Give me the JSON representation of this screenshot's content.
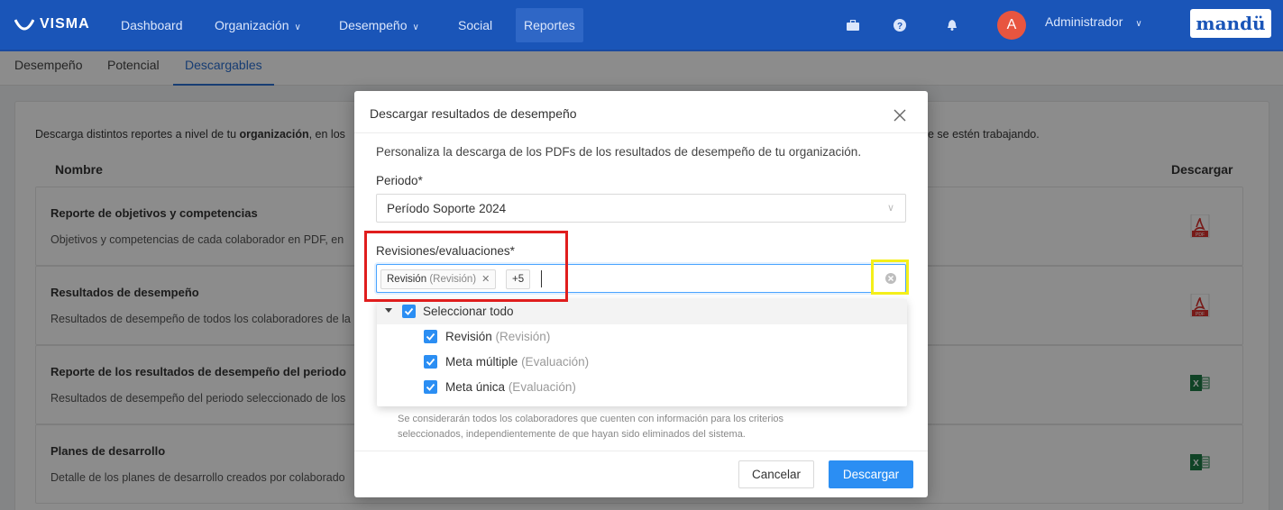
{
  "topbar": {
    "logo": "VISMA",
    "nav": [
      {
        "label": "Dashboard",
        "chevron": false
      },
      {
        "label": "Organización",
        "chevron": true
      },
      {
        "label": "Desempeño",
        "chevron": true
      },
      {
        "label": "Social",
        "chevron": false
      },
      {
        "label": "Reportes",
        "chevron": false,
        "active": true
      }
    ],
    "avatar_initial": "A",
    "user_name": "Administrador",
    "brand": "mandü",
    "icons": [
      "briefcase-icon",
      "help-icon",
      "bell-icon"
    ]
  },
  "subtabs": [
    {
      "label": "Desempeño"
    },
    {
      "label": "Potencial"
    },
    {
      "label": "Descargables",
      "active": true
    }
  ],
  "page": {
    "intro_left_prefix": "Descarga distintos reportes a nivel de tu ",
    "intro_left_bold": "organización",
    "intro_left_suffix": ", en los",
    "intro_right": "e se estén trabajando.",
    "col_name": "Nombre",
    "col_download": "Descargar",
    "reports": [
      {
        "title": "Reporte de objetivos y competencias",
        "desc": "Objetivos y competencias de cada colaborador en PDF, en",
        "file": "pdf"
      },
      {
        "title": "Resultados de desempeño",
        "desc": "Resultados de desempeño de todos los colaboradores de la",
        "file": "pdf"
      },
      {
        "title": "Reporte de los resultados de desempeño del periodo",
        "desc": "Resultados de desempeño del periodo seleccionado de los",
        "file": "excel"
      },
      {
        "title": "Planes de desarrollo",
        "desc": "Detalle de los planes de desarrollo creados por colaborado",
        "file": "excel"
      }
    ]
  },
  "modal": {
    "title": "Descargar resultados de desempeño",
    "description": "Personaliza la descarga de los PDFs de los resultados de desempeño de tu organización.",
    "period_label": "Periodo*",
    "period_value": "Período Soporte 2024",
    "reviews_label": "Revisiones/evaluaciones*",
    "tag": {
      "name": "Revisión",
      "type": "(Revisión)"
    },
    "more_count": "+5",
    "select_all": "Seleccionar todo",
    "options": [
      {
        "name": "Revisión",
        "type": "(Revisión)",
        "checked": true
      },
      {
        "name": "Meta múltiple",
        "type": "(Evaluación)",
        "checked": true
      },
      {
        "name": "Meta única",
        "type": "(Evaluación)",
        "checked": true
      }
    ],
    "footnote": "Se considerarán todos los colaboradores que cuenten con información para los criterios seleccionados, independientemente de que hayan sido eliminados del sistema.",
    "cancel_label": "Cancelar",
    "download_label": "Descargar"
  },
  "colors": {
    "navbar": "#1a55b8",
    "primary_button": "#2b8ef3",
    "highlight_red": "#e01d1d",
    "highlight_yellow": "#f4ef1a"
  }
}
